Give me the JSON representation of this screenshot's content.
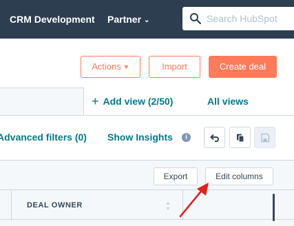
{
  "topnav": {
    "title": "CRM Development",
    "partner_label": "Partner",
    "search_placeholder": "Search HubSpot"
  },
  "actions": {
    "actions_label": "Actions",
    "import_label": "Import",
    "create_label": "Create deal"
  },
  "views": {
    "add_view_label": "Add view (2/50)",
    "all_views_label": "All views"
  },
  "filters": {
    "advanced_label": "Advanced filters (0)",
    "insights_label": "Show Insights",
    "info_glyph": "i"
  },
  "table": {
    "export_label": "Export",
    "edit_columns_label": "Edit columns",
    "column_header": "DEAL OWNER"
  },
  "colors": {
    "nav_bg": "#2d3e50",
    "accent_orange": "#ff7a59",
    "link_teal": "#007a8c",
    "annotation_red": "#e0231e"
  }
}
